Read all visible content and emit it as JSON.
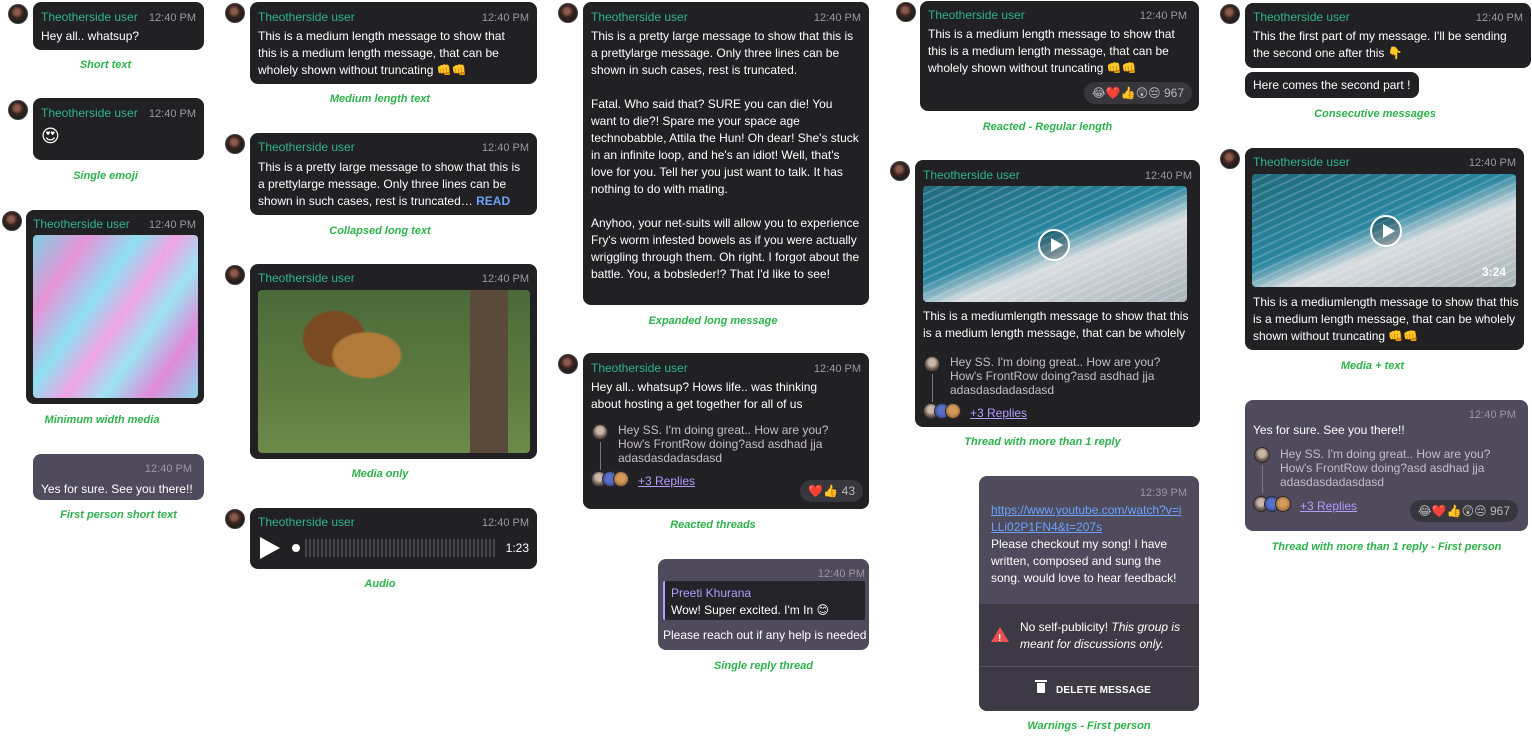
{
  "user": "Theotherside user",
  "time": "12:40 PM",
  "time2": "12:39 PM",
  "read_label": "READ",
  "short_text": "Hey all.. whatsup?",
  "single_emoji": "😍",
  "medium_text": "This is a medium length message to show that this is a medium length message, that can be wholely shown without truncating 👊👊",
  "collapsed_text": "This is a pretty large message to show that this is a prettylarge message. Only three lines can be shown in such cases, rest is truncated… ",
  "expanded_p1": "This is a pretty large message to show that this is a prettylarge message. Only three lines can be shown in such cases, rest is truncated.",
  "expanded_p2": "Fatal. Who said that? SURE you can die! You want to die?! Spare me your space age technobabble, Attila the Hun! Oh dear! She's stuck in an infinite loop, and he's an idiot! Well, that's love for you. Tell her you just want to talk. It has nothing to do with mating.",
  "expanded_p3": "Anyhoo, your net-suits will allow you to experience Fry's worm infested bowels as if you were actually wriggling through them. Oh right. I forgot about the battle. You, a bobsleder!? That I'd like to see!",
  "fp_short": "Yes for sure. See you there!!",
  "audio_duration": "1:23",
  "thread_text": "Hey all.. whatsup? Hows life.. was thinking about hosting a get together for all of us",
  "thread_reply": "Hey SS. I'm doing great.. How are you? How's FrontRow doing?asd asdhad jja adasdasdadasdasd",
  "replies_label": "+3 Replies",
  "reactions_small": "❤️👍",
  "reactions_small_count": "43",
  "reactions_big": "😂❤️👍😲😔",
  "reactions_big_count": "967",
  "single_reply": {
    "author": "Preeti Khurana",
    "quote": "Wow! Super excited. I'm In 😊",
    "text": "Please reach out if any help is needed"
  },
  "media_text": "This is a mediumlength message to show that this is a medium length message, that can be wholely",
  "media_text_full": "This is a mediumlength message to show that this is a medium length message, that can be wholely shown without truncating 👊👊",
  "video_duration": "3:24",
  "warning": {
    "link": "https://www.youtube.com/watch?v=iLLi02P1FN4&t=207s",
    "text": "Please checkout my song! I have written, composed and sung the song. would love to hear feedback!",
    "title": "No self-publicity!",
    "note": "This group is meant for discussions only.",
    "delete_label": "DELETE MESSAGE"
  },
  "consecutive_1": "This the first part of my message. I'll be sending the second one after this 👇",
  "consecutive_2": "Here comes the second part !",
  "captions": {
    "short": "Short text",
    "emoji": "Single emoji",
    "min_media": "Minimum width media",
    "fp_short": "First person short text",
    "medium": "Medium length text",
    "collapsed": "Collapsed long text",
    "media_only": "Media only",
    "audio": "Audio",
    "expanded": "Expanded long message",
    "reacted_threads": "Reacted threads",
    "single_reply": "Single reply thread",
    "reacted_regular": "Reacted - Regular length",
    "thread_more": "Thread with more than 1 reply",
    "warnings": "Warnings - First person",
    "consecutive": "Consecutive messages",
    "media_text": "Media + text",
    "thread_fp": "Thread with more than 1 reply - First person"
  }
}
